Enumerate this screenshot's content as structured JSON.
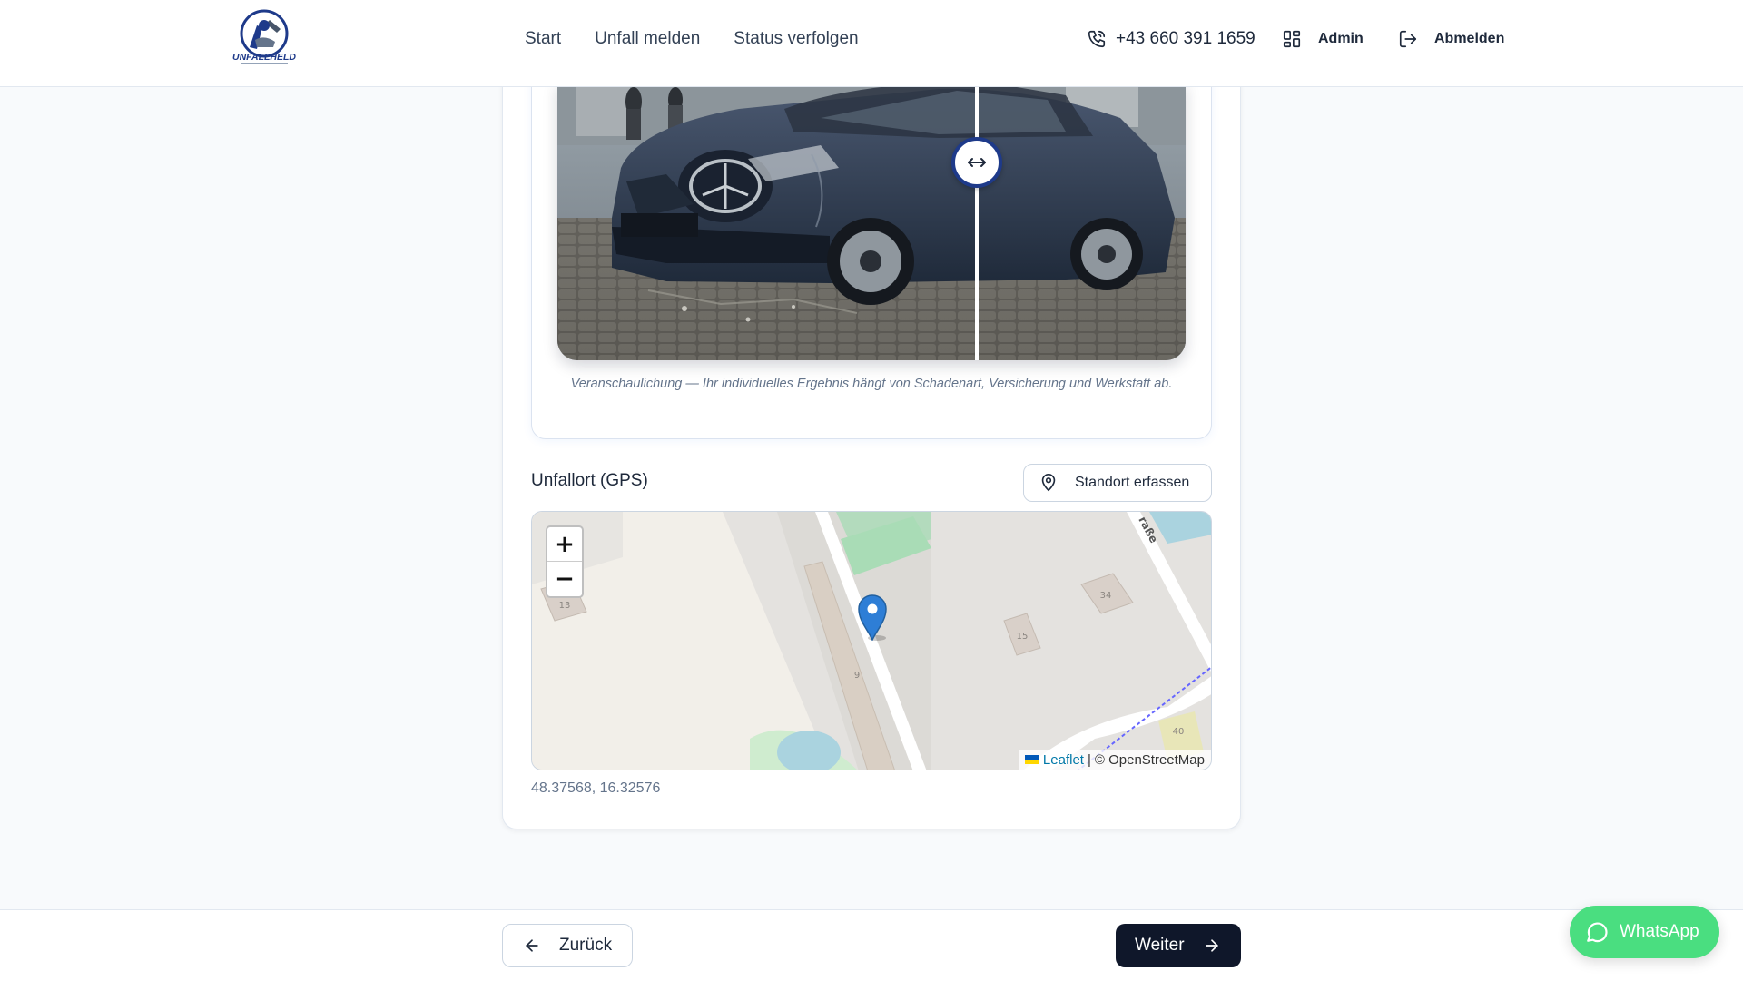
{
  "header": {
    "nav": [
      {
        "label": "Start"
      },
      {
        "label": "Unfall melden"
      },
      {
        "label": "Status verfolgen"
      }
    ],
    "phone": "+43 660 391 1659",
    "admin_label": "Admin",
    "logout_label": "Abmelden",
    "logo_text": "UNFALLHELD"
  },
  "comparison": {
    "caption": "Veranschaulichung — Ihr individuelles Ergebnis hängt von Schadenart, Versicherung und Werkstatt ab.",
    "slider_position": 0.67
  },
  "location": {
    "label": "Unfallort (GPS)",
    "capture_button": "Standort erfassen",
    "coordinates": "48.37568, 16.32576"
  },
  "map": {
    "zoom_in": "+",
    "zoom_out": "−",
    "attribution_leaflet": "Leaflet",
    "attribution_separator": "|",
    "attribution_osm": "© OpenStreetMap",
    "street_label": "raße",
    "house_numbers": [
      "13",
      "9",
      "15",
      "34",
      "40"
    ]
  },
  "footer": {
    "back_label": "Zurück",
    "next_label": "Weiter",
    "whatsapp_label": "WhatsApp"
  },
  "colors": {
    "primary_dark": "#0f172a",
    "whatsapp": "#4ade80",
    "slider_ring": "#1e3a8a",
    "leaflet_link": "#0078a8"
  }
}
